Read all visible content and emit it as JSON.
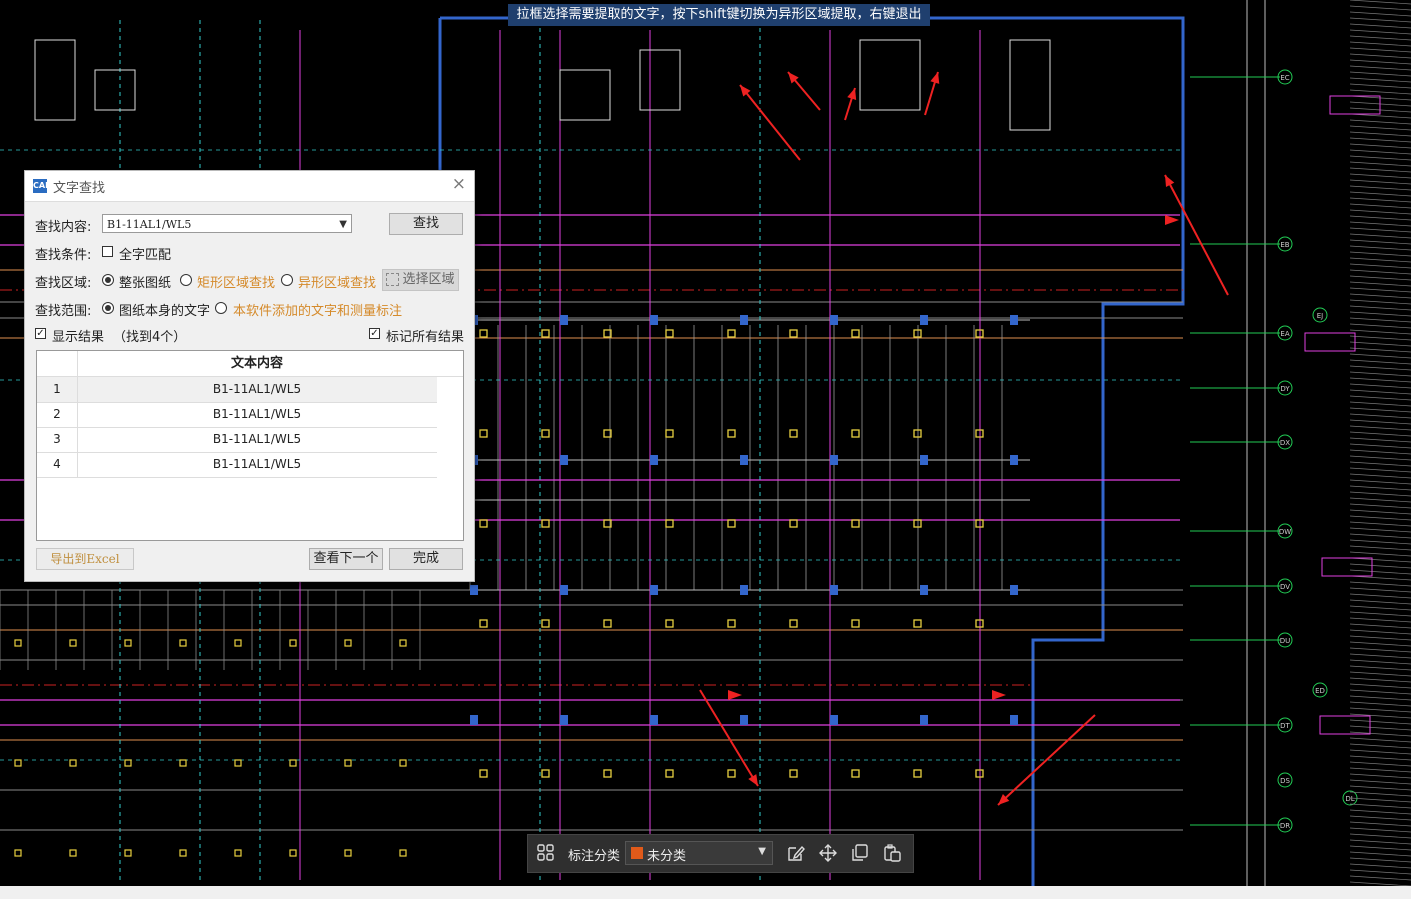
{
  "hint_bar": {
    "text": "拉框选择需要提取的文字，按下shift键切换为异形区域提取，右键退出"
  },
  "dialog": {
    "title": "文字查找",
    "icon_name": "app-logo-icon",
    "close_icon": "close-icon",
    "search_label": "查找内容:",
    "search_value": "B1-11AL1/WL5",
    "find_button": "查找",
    "condition_label": "查找条件:",
    "whole_match_label": "全字匹配",
    "whole_match_checked": false,
    "area_label": "查找区域:",
    "area_options": [
      {
        "label": "整张图纸",
        "selected": true,
        "enabled": true
      },
      {
        "label": "矩形区域查找",
        "selected": false,
        "enabled": false
      },
      {
        "label": "异形区域查找",
        "selected": false,
        "enabled": false
      }
    ],
    "select_area_button": "选择区域",
    "scope_label": "查找范围:",
    "scope_options": [
      {
        "label": "图纸本身的文字",
        "selected": true
      },
      {
        "label": "本软件添加的文字和测量标注",
        "selected": false
      }
    ],
    "show_results_label": "显示结果",
    "show_results_checked": true,
    "found_count": "（找到4个）",
    "mark_all_label": "标记所有结果",
    "mark_all_checked": true,
    "table_header": "文本内容",
    "results": [
      {
        "index": "1",
        "text": "B1-11AL1/WL5"
      },
      {
        "index": "2",
        "text": "B1-11AL1/WL5"
      },
      {
        "index": "3",
        "text": "B1-11AL1/WL5"
      },
      {
        "index": "4",
        "text": "B1-11AL1/WL5"
      }
    ],
    "export_button": "导出到Excel",
    "next_button": "查看下一个",
    "done_button": "完成"
  },
  "toolbar": {
    "grid_icon": "grid-icon",
    "label": "标注分类",
    "category_value": "未分类",
    "category_color": "#e05a1a",
    "tools": [
      "edit-icon",
      "move-icon",
      "copy-icon",
      "paste-icon"
    ]
  },
  "axis_labels_right": [
    "EC",
    "EB",
    "EA",
    "DY",
    "DX",
    "DW",
    "DV",
    "DU",
    "DT",
    "DS",
    "DR"
  ],
  "axis_labels_far_right": [
    "EJ",
    "ED",
    "DL"
  ],
  "drawing_colors": {
    "wall": "#3366cc",
    "magenta": "#e040e0",
    "cyan": "#33cccc",
    "yellow": "#e8d040",
    "red_arrow": "#ee2222"
  }
}
